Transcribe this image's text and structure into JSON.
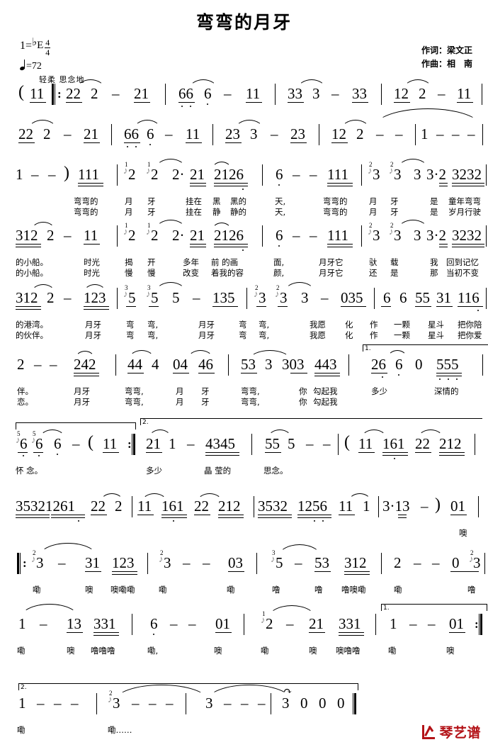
{
  "header": {
    "title": "弯弯的月牙",
    "key_label": "1=",
    "key_accidental": "♭",
    "key_letter": "E",
    "meter_num": "4",
    "meter_den": "4",
    "tempo": "=72",
    "expression": "轻柔 思念地",
    "lyricist": "作词：梁文正",
    "composer": "作曲：相　南"
  },
  "logo": {
    "text": "琴艺谱"
  },
  "lines": [
    {
      "id": "line-1",
      "measures": [
        {
          "notes": "( 11 ‖: 22 2 - 21"
        },
        {
          "notes": "66 6 - 11"
        },
        {
          "notes": "33 3 - 33"
        },
        {
          "notes": "12 2 - 11"
        }
      ]
    },
    {
      "id": "line-2",
      "measures": [
        {
          "notes": "22 2 - 21"
        },
        {
          "notes": "66 6 - 11"
        },
        {
          "notes": "23 3 - 23"
        },
        {
          "notes": "12 2 - -"
        },
        {
          "notes": "1 - - -"
        }
      ]
    },
    {
      "id": "line-3",
      "measures": [
        {
          "notes": "1 - - ) 111"
        },
        {
          "notes": "2 2 2· 21 2126"
        },
        {
          "notes": "6 - - 111"
        },
        {
          "notes": "3 3 3 3·2 3232"
        }
      ],
      "lyrics1": [
        "弯弯的",
        "月",
        "牙",
        "挂在",
        "黑",
        "黑的",
        "天,",
        "弯弯的",
        "月",
        "牙",
        "是",
        "童年弯弯"
      ],
      "lyrics2": [
        "弯弯的",
        "月",
        "牙",
        "挂在",
        "静",
        "静的",
        "天,",
        "弯弯的",
        "月",
        "牙",
        "是",
        "岁月行驶"
      ]
    },
    {
      "id": "line-4",
      "measures": [
        {
          "notes": "312 2 - 11"
        },
        {
          "notes": "2 2 2· 21 2126"
        },
        {
          "notes": "6 - - 111"
        },
        {
          "notes": "3 3 3 3·2 3232"
        }
      ],
      "lyrics1": [
        "的小船。",
        "时光",
        "揭",
        "开",
        "多年",
        "前 的画",
        "面,",
        "月牙它",
        "驮",
        "载",
        "我",
        "回到记忆"
      ],
      "lyrics2": [
        "的小船。",
        "时光",
        "慢",
        "慢",
        "改变",
        "着我的容",
        "颜,",
        "月牙它",
        "还",
        "是",
        "那",
        "当初不变"
      ]
    },
    {
      "id": "line-5",
      "measures": [
        {
          "notes": "312 2 - 123"
        },
        {
          "notes": "5 5 5 - 135"
        },
        {
          "notes": "3 3 3 - 035"
        },
        {
          "notes": "6 6 55 31 116"
        }
      ],
      "lyrics1": [
        "的港湾。",
        "月牙",
        "弯",
        "弯,",
        "月牙",
        "弯",
        "弯,",
        "我愿",
        "化",
        "作",
        "一颗",
        "星斗",
        "把你陪"
      ],
      "lyrics2": [
        "的伙伴。",
        "月牙",
        "弯",
        "弯,",
        "月牙",
        "弯",
        "弯,",
        "我愿",
        "化",
        "作",
        "一颗",
        "星斗",
        "把你爱"
      ]
    },
    {
      "id": "line-6",
      "measures": [
        {
          "notes": "2 - - 242"
        },
        {
          "notes": "44 4 04 46"
        },
        {
          "notes": "53 3 303 443"
        },
        {
          "notes": "26 6 0 555",
          "volta": "1."
        }
      ],
      "lyrics1": [
        "伴。",
        "月牙",
        "弯弯,",
        "月",
        "牙",
        "弯弯,",
        "你",
        "勾起我",
        "多少",
        "深情的"
      ],
      "lyrics2": [
        "恋。",
        "月牙",
        "弯弯,",
        "月",
        "牙",
        "弯弯,",
        "你",
        "勾起我"
      ]
    },
    {
      "id": "line-7",
      "measures": [
        {
          "notes": "6 6 6 - ( 11 :‖"
        },
        {
          "notes": "21 1 - 4345",
          "volta": "2."
        },
        {
          "notes": "55 5 - -"
        },
        {
          "notes": "( 11 161 22 212"
        }
      ],
      "lyrics1": [
        "怀 念。",
        "多少",
        "晶 莹的",
        "思念。"
      ]
    },
    {
      "id": "line-8",
      "measures": [
        {
          "notes": "35321261 22 2"
        },
        {
          "notes": "11 161 22 212"
        },
        {
          "notes": "3532 1256 11 1"
        },
        {
          "notes": "3·13 - ) 01"
        }
      ],
      "lyrics1": [
        "噢"
      ]
    },
    {
      "id": "line-9",
      "measures": [
        {
          "notes": "‖: 3 - 31 123"
        },
        {
          "notes": "3 - - 03"
        },
        {
          "notes": "5 - 53 312"
        },
        {
          "notes": "2 - - 0 3"
        }
      ],
      "lyrics1": [
        "嘞",
        "噢",
        "噢嘞嘞",
        "嘞",
        "嘞",
        "噜",
        "噜",
        "噜噢嘞",
        "嘞",
        "噜"
      ]
    },
    {
      "id": "line-10",
      "measures": [
        {
          "notes": "1 - 13 331"
        },
        {
          "notes": "6 - - 01"
        },
        {
          "notes": "2 - 21 331"
        },
        {
          "notes": "1 - - 01 :‖",
          "volta": "1."
        }
      ],
      "lyrics1": [
        "嘞",
        "噢",
        "噜噜噜",
        "嘞,",
        "噢",
        "嘞",
        "噢",
        "噢噜噜",
        "嘞",
        "噢"
      ]
    },
    {
      "id": "line-11",
      "measures": [
        {
          "notes": "1 - - -",
          "volta": "2."
        },
        {
          "notes": "3 - - -"
        },
        {
          "notes": "3 - - -"
        },
        {
          "notes": "3 0 0 0 ‖"
        }
      ],
      "lyrics1": [
        "嘞",
        "嘞……"
      ]
    }
  ]
}
